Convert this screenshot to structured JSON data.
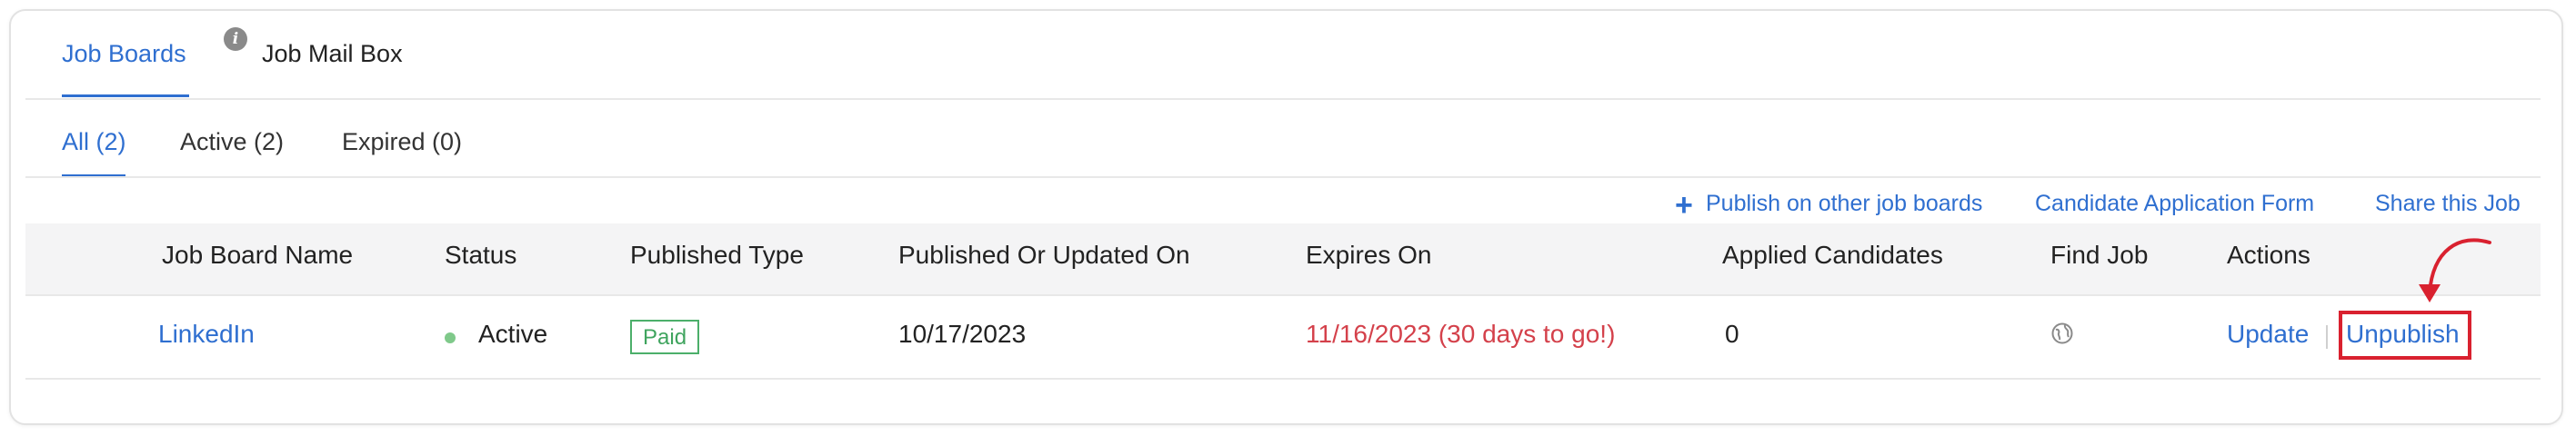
{
  "top_tabs": [
    {
      "label": "Job Boards",
      "active": true
    },
    {
      "label": "Job Mail Box",
      "active": false
    }
  ],
  "filter_tabs": [
    {
      "label": "All (2)",
      "active": true
    },
    {
      "label": "Active (2)",
      "active": false
    },
    {
      "label": "Expired (0)",
      "active": false
    }
  ],
  "actions_bar": {
    "publish_icon": "+",
    "publish_label": "Publish on other job boards",
    "application_form_label": "Candidate Application Form",
    "share_label": "Share this Job"
  },
  "table": {
    "columns": [
      "Job Board Name",
      "Status",
      "Published Type",
      "Published Or Updated On",
      "Expires On",
      "Applied Candidates",
      "Find Job",
      "Actions"
    ],
    "rows": [
      {
        "job_board_name": "LinkedIn",
        "status": "Active",
        "published_type": "Paid",
        "published_on": "10/17/2023",
        "expires_on": "11/16/2023 (30 days to go!)",
        "applied_candidates": "0",
        "find_job_icon": "globe-icon",
        "update_label": "Update",
        "unpublish_label": "Unpublish"
      }
    ]
  },
  "colors": {
    "link": "#2f6fd0",
    "expiry_warning": "#d4414b",
    "status_active": "#7fc98a",
    "paid_badge": "#4caf6a",
    "highlight": "#d9212f"
  }
}
